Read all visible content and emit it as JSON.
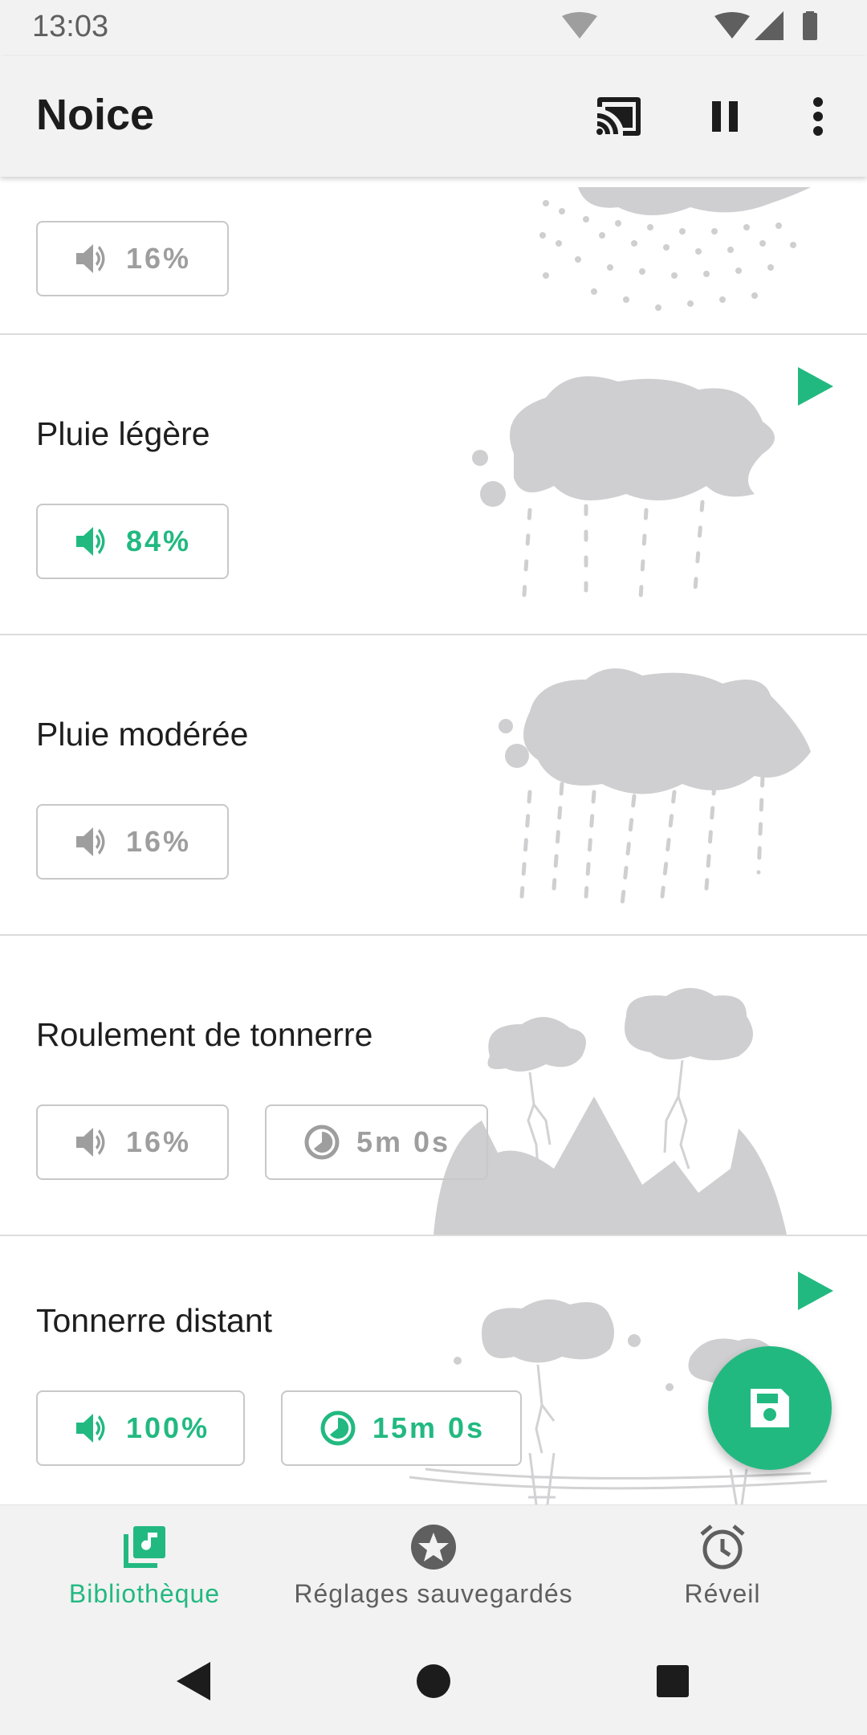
{
  "status_bar": {
    "time": "13:03"
  },
  "app_bar": {
    "title": "Noice"
  },
  "sounds": [
    {
      "title": "",
      "volume": "16%",
      "active": false,
      "timer": null
    },
    {
      "title": "Pluie légère",
      "volume": "84%",
      "active": true,
      "timer": null
    },
    {
      "title": "Pluie modérée",
      "volume": "16%",
      "active": false,
      "timer": null
    },
    {
      "title": "Roulement de tonnerre",
      "volume": "16%",
      "active": false,
      "timer": "5m 0s"
    },
    {
      "title": "Tonnerre distant",
      "volume": "100%",
      "active": true,
      "timer": "15m 0s"
    }
  ],
  "bottom_nav": {
    "items": [
      {
        "label": "Bibliothèque",
        "icon": "library-music-icon",
        "selected": true
      },
      {
        "label": "Réglages sauvegardés",
        "icon": "star-circle-icon",
        "selected": false
      },
      {
        "label": "Réveil",
        "icon": "alarm-clock-icon",
        "selected": false
      }
    ]
  },
  "colors": {
    "accent": "#22b981",
    "inactive": "#9e9e9e",
    "bar": "#f2f2f2"
  }
}
